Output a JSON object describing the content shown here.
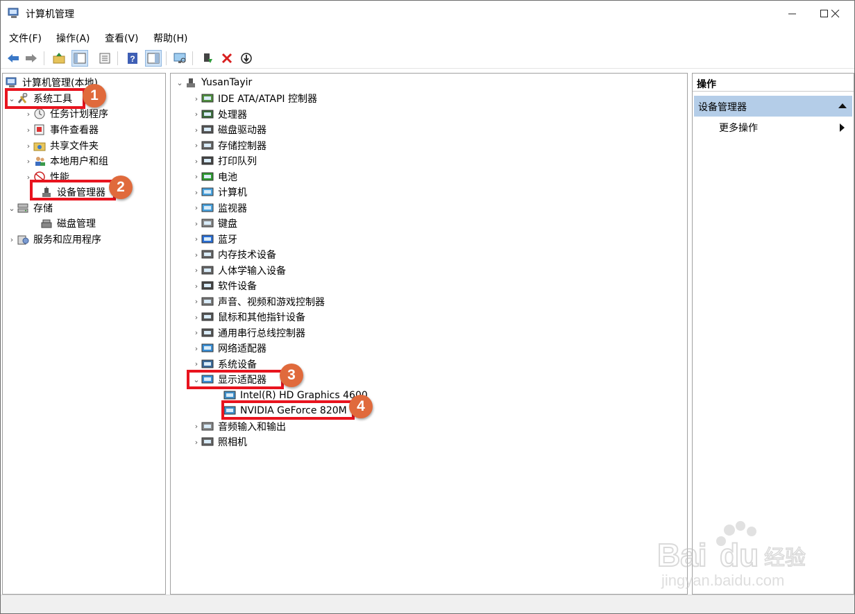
{
  "window": {
    "title": "计算机管理",
    "controls": [
      "minimize",
      "maximize",
      "close"
    ]
  },
  "menu": [
    "文件(F)",
    "操作(A)",
    "查看(V)",
    "帮助(H)"
  ],
  "toolbar": {
    "icons": [
      "back-icon",
      "forward-icon",
      "up-folder-icon",
      "show-tree-icon",
      "properties-icon",
      "help-icon",
      "show-action-pane-icon",
      "monitor-icon",
      "enable-device-icon",
      "uninstall-icon",
      "update-driver-icon"
    ]
  },
  "left_tree": {
    "root": "计算机管理(本地)",
    "system_tools": "系统工具",
    "system_children": [
      "任务计划程序",
      "事件查看器",
      "共享文件夹",
      "本地用户和组",
      "性能",
      "设备管理器"
    ],
    "storage": "存储",
    "storage_children": [
      "磁盘管理"
    ],
    "services": "服务和应用程序"
  },
  "device_tree": {
    "root": "YusanTayir",
    "categories": [
      "IDE ATA/ATAPI 控制器",
      "处理器",
      "磁盘驱动器",
      "存储控制器",
      "打印队列",
      "电池",
      "计算机",
      "监视器",
      "键盘",
      "蓝牙",
      "内存技术设备",
      "人体学输入设备",
      "软件设备",
      "声音、视频和游戏控制器",
      "鼠标和其他指针设备",
      "通用串行总线控制器",
      "网络适配器",
      "系统设备"
    ],
    "expanded": "显示适配器",
    "display_children": [
      "Intel(R) HD Graphics 4600",
      "NVIDIA GeForce 820M"
    ],
    "after": [
      "音频输入和输出",
      "照相机"
    ]
  },
  "actions": {
    "header": "操作",
    "group": "设备管理器",
    "more": "更多操作"
  },
  "annotations": [
    "1",
    "2",
    "3",
    "4"
  ],
  "watermark": {
    "brand": "Baidu经验",
    "url": "jingyan.baidu.com"
  },
  "colors": {
    "highlight_box": "#e8141e",
    "badge": "#e06a3c",
    "selected_group": "#b4cde8"
  }
}
